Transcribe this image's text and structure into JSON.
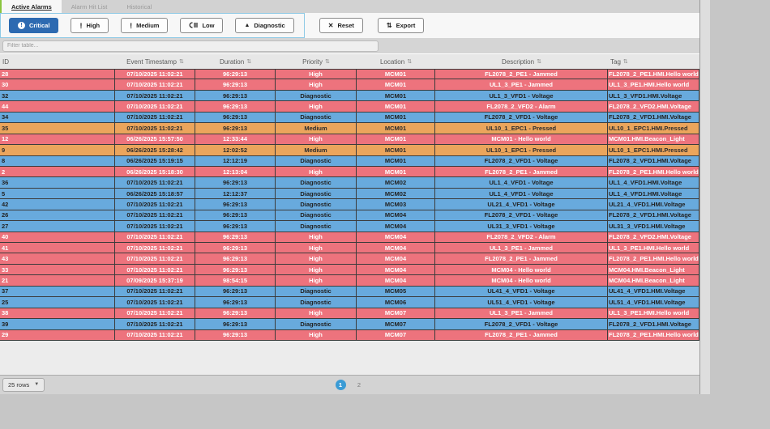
{
  "tabs": [
    {
      "label": "Active Alarms",
      "active": true
    },
    {
      "label": "Alarm Hit List",
      "active": false
    },
    {
      "label": "Historical",
      "active": false
    }
  ],
  "toolbar": {
    "filters": [
      {
        "label": "Critical",
        "icon": "exclamation-circle-icon",
        "active": true
      },
      {
        "label": "High",
        "icon": "exclamation-icon",
        "active": false
      },
      {
        "label": "Medium",
        "icon": "exclamation-icon",
        "active": false
      },
      {
        "label": "Low",
        "icon": "low-priority-icon",
        "active": false
      },
      {
        "label": "Diagnostic",
        "icon": "warning-triangle-icon",
        "active": false
      }
    ],
    "reset_label": "Reset",
    "export_label": "Export"
  },
  "filter_input": {
    "placeholder": "Filter table..."
  },
  "table": {
    "columns": [
      "ID",
      "Event Timestamp",
      "Duration",
      "Priority",
      "Location",
      "Description",
      "Tag"
    ],
    "rows": [
      {
        "id": "28",
        "timestamp": "07/10/2025 11:02:21",
        "duration": "96:29:13",
        "priority": "High",
        "location": "MCM01",
        "description": "FL2078_2_PE1 - Jammed",
        "tag": "FL2078_2_PE1.HMI.Hello world"
      },
      {
        "id": "30",
        "timestamp": "07/10/2025 11:02:21",
        "duration": "96:29:13",
        "priority": "High",
        "location": "MCM01",
        "description": "UL1_3_PE1 - Jammed",
        "tag": "UL1_3_PE1.HMI.Hello world"
      },
      {
        "id": "32",
        "timestamp": "07/10/2025 11:02:21",
        "duration": "96:29:13",
        "priority": "Diagnostic",
        "location": "MCM01",
        "description": "UL1_3_VFD1 - Voltage",
        "tag": "UL1_3_VFD1.HMI.Voltage"
      },
      {
        "id": "44",
        "timestamp": "07/10/2025 11:02:21",
        "duration": "96:29:13",
        "priority": "High",
        "location": "MCM01",
        "description": "FL2078_2_VFD2 - Alarm",
        "tag": "FL2078_2_VFD2.HMI.Voltage"
      },
      {
        "id": "34",
        "timestamp": "07/10/2025 11:02:21",
        "duration": "96:29:13",
        "priority": "Diagnostic",
        "location": "MCM01",
        "description": "FL2078_2_VFD1 - Voltage",
        "tag": "FL2078_2_VFD1.HMI.Voltage"
      },
      {
        "id": "35",
        "timestamp": "07/10/2025 11:02:21",
        "duration": "96:29:13",
        "priority": "Medium",
        "location": "MCM01",
        "description": "UL10_1_EPC1 - Pressed",
        "tag": "UL10_1_EPC1.HMI.Pressed"
      },
      {
        "id": "12",
        "timestamp": "06/26/2025 15:57:50",
        "duration": "12:33:44",
        "priority": "High",
        "location": "MCM01",
        "description": "MCM01 - Hello world",
        "tag": "MCM01.HMI.Beacon_Light"
      },
      {
        "id": "9",
        "timestamp": "06/26/2025 15:28:42",
        "duration": "12:02:52",
        "priority": "Medium",
        "location": "MCM01",
        "description": "UL10_1_EPC1 - Pressed",
        "tag": "UL10_1_EPC1.HMI.Pressed"
      },
      {
        "id": "8",
        "timestamp": "06/26/2025 15:19:15",
        "duration": "12:12:19",
        "priority": "Diagnostic",
        "location": "MCM01",
        "description": "FL2078_2_VFD1 - Voltage",
        "tag": "FL2078_2_VFD1.HMI.Voltage"
      },
      {
        "id": "2",
        "timestamp": "06/26/2025 15:18:30",
        "duration": "12:13:04",
        "priority": "High",
        "location": "MCM01",
        "description": "FL2078_2_PE1 - Jammed",
        "tag": "FL2078_2_PE1.HMI.Hello world"
      },
      {
        "id": "36",
        "timestamp": "07/10/2025 11:02:21",
        "duration": "96:29:13",
        "priority": "Diagnostic",
        "location": "MCM02",
        "description": "UL1_4_VFD1 - Voltage",
        "tag": "UL1_4_VFD1.HMI.Voltage"
      },
      {
        "id": "5",
        "timestamp": "06/26/2025 15:18:57",
        "duration": "12:12:37",
        "priority": "Diagnostic",
        "location": "MCM02",
        "description": "UL1_4_VFD1 - Voltage",
        "tag": "UL1_4_VFD1.HMI.Voltage"
      },
      {
        "id": "42",
        "timestamp": "07/10/2025 11:02:21",
        "duration": "96:29:13",
        "priority": "Diagnostic",
        "location": "MCM03",
        "description": "UL21_4_VFD1 - Voltage",
        "tag": "UL21_4_VFD1.HMI.Voltage"
      },
      {
        "id": "26",
        "timestamp": "07/10/2025 11:02:21",
        "duration": "96:29:13",
        "priority": "Diagnostic",
        "location": "MCM04",
        "description": "FL2078_2_VFD1 - Voltage",
        "tag": "FL2078_2_VFD1.HMI.Voltage"
      },
      {
        "id": "27",
        "timestamp": "07/10/2025 11:02:21",
        "duration": "96:29:13",
        "priority": "Diagnostic",
        "location": "MCM04",
        "description": "UL31_3_VFD1 - Voltage",
        "tag": "UL31_3_VFD1.HMI.Voltage"
      },
      {
        "id": "40",
        "timestamp": "07/10/2025 11:02:21",
        "duration": "96:29:13",
        "priority": "High",
        "location": "MCM04",
        "description": "FL2078_2_VFD2 - Alarm",
        "tag": "FL2078_2_VFD2.HMI.Voltage"
      },
      {
        "id": "41",
        "timestamp": "07/10/2025 11:02:21",
        "duration": "96:29:13",
        "priority": "High",
        "location": "MCM04",
        "description": "UL1_3_PE1 - Jammed",
        "tag": "UL1_3_PE1.HMI.Hello world"
      },
      {
        "id": "43",
        "timestamp": "07/10/2025 11:02:21",
        "duration": "96:29:13",
        "priority": "High",
        "location": "MCM04",
        "description": "FL2078_2_PE1 - Jammed",
        "tag": "FL2078_2_PE1.HMI.Hello world"
      },
      {
        "id": "33",
        "timestamp": "07/10/2025 11:02:21",
        "duration": "96:29:13",
        "priority": "High",
        "location": "MCM04",
        "description": "MCM04 - Hello world",
        "tag": "MCM04.HMI.Beacon_Light"
      },
      {
        "id": "21",
        "timestamp": "07/09/2025 15:37:19",
        "duration": "98:54:15",
        "priority": "High",
        "location": "MCM04",
        "description": "MCM04 - Hello world",
        "tag": "MCM04.HMI.Beacon_Light"
      },
      {
        "id": "37",
        "timestamp": "07/10/2025 11:02:21",
        "duration": "96:29:13",
        "priority": "Diagnostic",
        "location": "MCM05",
        "description": "UL41_4_VFD1 - Voltage",
        "tag": "UL41_4_VFD1.HMI.Voltage"
      },
      {
        "id": "25",
        "timestamp": "07/10/2025 11:02:21",
        "duration": "96:29:13",
        "priority": "Diagnostic",
        "location": "MCM06",
        "description": "UL51_4_VFD1 - Voltage",
        "tag": "UL51_4_VFD1.HMI.Voltage"
      },
      {
        "id": "38",
        "timestamp": "07/10/2025 11:02:21",
        "duration": "96:29:13",
        "priority": "High",
        "location": "MCM07",
        "description": "UL1_3_PE1 - Jammed",
        "tag": "UL1_3_PE1.HMI.Hello world"
      },
      {
        "id": "39",
        "timestamp": "07/10/2025 11:02:21",
        "duration": "96:29:13",
        "priority": "Diagnostic",
        "location": "MCM07",
        "description": "FL2078_2_VFD1 - Voltage",
        "tag": "FL2078_2_VFD1.HMI.Voltage"
      },
      {
        "id": "29",
        "timestamp": "07/10/2025 11:02:21",
        "duration": "96:29:13",
        "priority": "High",
        "location": "MCM07",
        "description": "FL2078_2_PE1 - Jammed",
        "tag": "FL2078_2_PE1.HMI.Hello world"
      }
    ]
  },
  "pagination": {
    "rows_select_value": "25 rows",
    "pages": [
      "1",
      "2"
    ],
    "active_page": "1"
  },
  "colors": {
    "high_row": "#ed737d",
    "medium_row": "#eba55c",
    "diagnostic_row": "#68aadd",
    "critical_button": "#2d6ab1",
    "active_page": "#3a9bd5",
    "filter_group_border": "#8ecae6"
  }
}
